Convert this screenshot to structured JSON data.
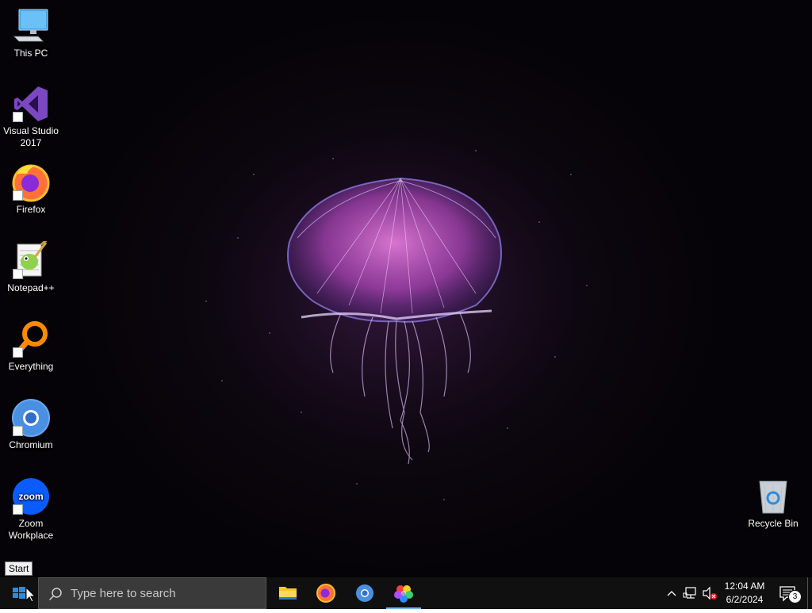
{
  "desktop": {
    "icons": [
      {
        "label": "This PC",
        "icon": "computer-icon"
      },
      {
        "label": "Visual Studio 2017",
        "icon": "visual-studio-icon"
      },
      {
        "label": "Firefox",
        "icon": "firefox-icon"
      },
      {
        "label": "Notepad++",
        "icon": "notepad-plus-plus-icon"
      },
      {
        "label": "Everything",
        "icon": "everything-search-icon"
      },
      {
        "label": "Chromium",
        "icon": "chromium-icon"
      },
      {
        "label": "Zoom Workplace",
        "icon": "zoom-icon"
      },
      {
        "label": "Recycle Bin",
        "icon": "recycle-bin-icon"
      }
    ]
  },
  "tooltip": {
    "text": "Start"
  },
  "taskbar": {
    "search_placeholder": "Type here to search",
    "pinned_apps": [
      {
        "name": "File Explorer",
        "icon": "folder-icon"
      },
      {
        "name": "Firefox",
        "icon": "firefox-icon"
      },
      {
        "name": "Chromium",
        "icon": "chromium-icon"
      },
      {
        "name": "Photos",
        "icon": "color-wheel-icon",
        "active": true
      }
    ],
    "clock": {
      "time": "12:04 AM",
      "date": "6/2/2024"
    },
    "notifications_count": "3"
  },
  "colors": {
    "taskbar_bg": "#101010",
    "search_bg": "#3a3a3a",
    "active_indicator": "#76b9ed",
    "windows_blue": "#2b8cde"
  }
}
